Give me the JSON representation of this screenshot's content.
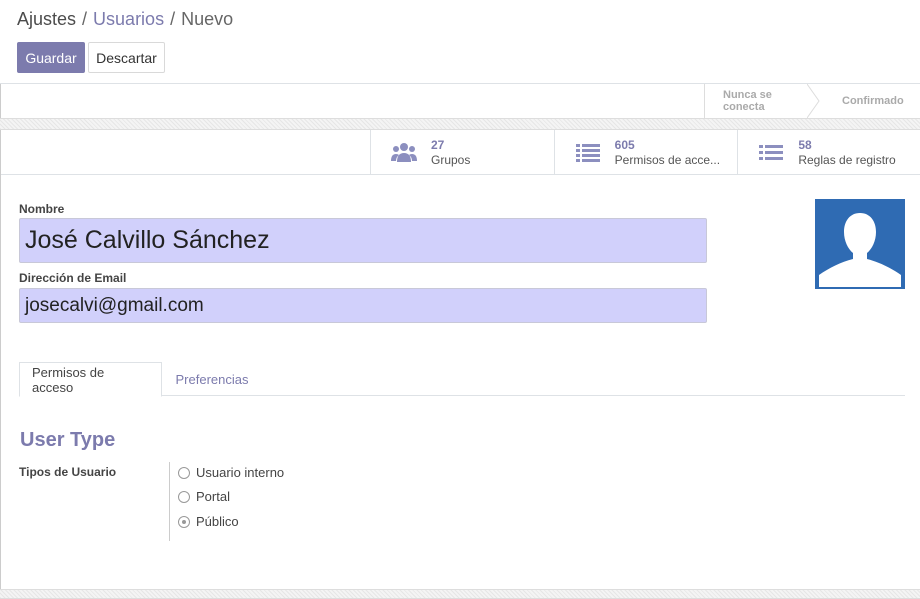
{
  "breadcrumb": {
    "root": "Ajustes",
    "parent": "Usuarios",
    "current": "Nuevo",
    "separator": "/"
  },
  "toolbar": {
    "save_label": "Guardar",
    "discard_label": "Descartar"
  },
  "statusbar": {
    "steps": [
      "Nunca se conecta",
      "Confirmado"
    ]
  },
  "stat_buttons": [
    {
      "value": "27",
      "label": "Grupos",
      "icon": "users-icon"
    },
    {
      "value": "605",
      "label": "Permisos de acce...",
      "icon": "list-icon"
    },
    {
      "value": "58",
      "label": "Reglas de registro",
      "icon": "list-icon"
    }
  ],
  "form": {
    "name_label": "Nombre",
    "name_value": "José Calvillo Sánchez",
    "email_label": "Dirección de Email",
    "email_value": "josecalvi@gmail.com"
  },
  "tabs": [
    {
      "label": "Permisos de acceso",
      "active": true
    },
    {
      "label": "Preferencias",
      "active": false
    }
  ],
  "user_type": {
    "title": "User Type",
    "field_label": "Tipos de Usuario",
    "options": [
      {
        "label": "Usuario interno",
        "checked": false
      },
      {
        "label": "Portal",
        "checked": false
      },
      {
        "label": "Público",
        "checked": true
      }
    ]
  },
  "colors": {
    "accent": "#7c7bad",
    "input_bg": "#d1d0fb",
    "avatar_bg": "#2f6bb3"
  }
}
